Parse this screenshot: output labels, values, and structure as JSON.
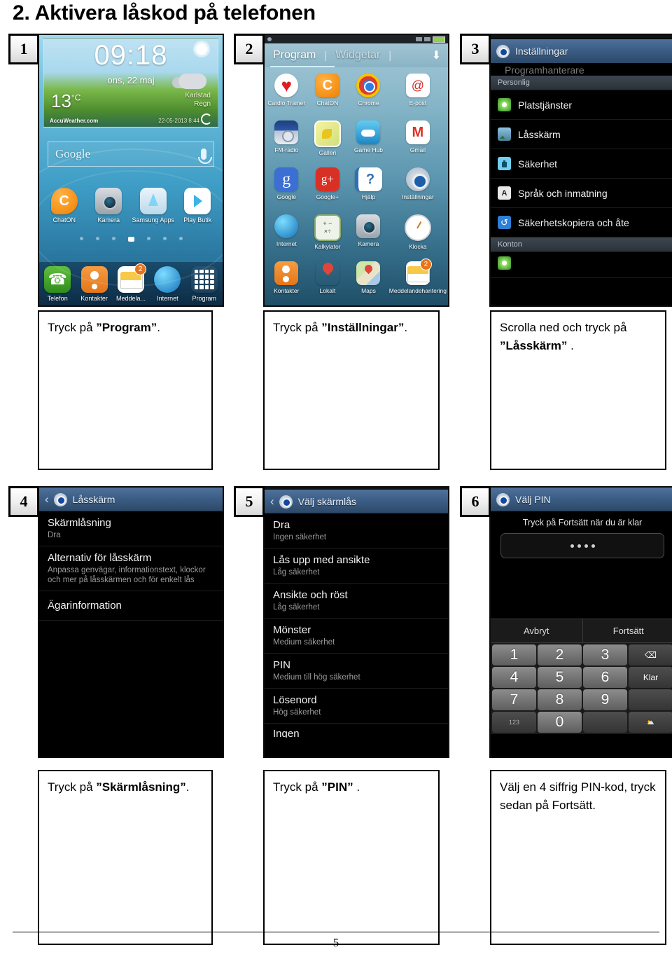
{
  "page": {
    "title": "2. Aktivera låskod på telefonen",
    "number": "5"
  },
  "steps": [
    {
      "number": "1",
      "caption_pre": "Tryck på ",
      "caption_bold": "”Program”",
      "caption_post": "."
    },
    {
      "number": "2",
      "caption_pre": "Tryck på ",
      "caption_bold": "”Inställningar”",
      "caption_post": "."
    },
    {
      "number": "3",
      "caption_pre": "Scrolla ned och tryck på ",
      "caption_bold": "”Låsskärm”",
      "caption_post": " ."
    },
    {
      "number": "4",
      "caption_pre": "Tryck på ",
      "caption_bold": "”Skärmlåsning”",
      "caption_post": "."
    },
    {
      "number": "5",
      "caption_pre": "Tryck på ",
      "caption_bold": "”PIN”",
      "caption_post": " ."
    },
    {
      "number": "6",
      "caption_pre": "Välj en 4 siffrig PIN-kod, tryck sedan på Fortsätt.",
      "caption_bold": "",
      "caption_post": ""
    }
  ],
  "panel1": {
    "widget": {
      "clock": "09:18",
      "date": "ons, 22 maj",
      "temperature": "13",
      "degree": "°C",
      "city": "Karlstad",
      "condition": "Regn",
      "brand": "AccuWeather.com",
      "updated": "22-05-2013 8:44"
    },
    "search": {
      "label": "Google"
    },
    "apps": [
      {
        "label": "ChatON",
        "icon": "chaton-icon"
      },
      {
        "label": "Kamera",
        "icon": "camera-icon"
      },
      {
        "label": "Samsung Apps",
        "icon": "samsung-apps-icon"
      },
      {
        "label": "Play Butik",
        "icon": "play-store-icon"
      }
    ],
    "dock": [
      {
        "label": "Telefon",
        "icon": "phone-icon",
        "badge": ""
      },
      {
        "label": "Kontakter",
        "icon": "contacts-icon",
        "badge": ""
      },
      {
        "label": "Meddela...",
        "icon": "messages-icon",
        "badge": "2"
      },
      {
        "label": "Internet",
        "icon": "browser-icon",
        "badge": ""
      },
      {
        "label": "Program",
        "icon": "app-drawer-icon",
        "badge": ""
      }
    ]
  },
  "panel2": {
    "tabs": {
      "apps": "Program",
      "widgets": "Widgetar",
      "separator": "|",
      "download_icon": "download-icon"
    },
    "apps": [
      {
        "label": "Cardio Trainer",
        "icon": "cardio-trainer-icon"
      },
      {
        "label": "ChatON",
        "icon": "chaton-icon"
      },
      {
        "label": "Chrome",
        "icon": "chrome-icon"
      },
      {
        "label": "E-post",
        "icon": "email-icon"
      },
      {
        "label": "FM-radio",
        "icon": "fm-radio-icon"
      },
      {
        "label": "Galleri",
        "icon": "gallery-icon"
      },
      {
        "label": "Game Hub",
        "icon": "game-hub-icon"
      },
      {
        "label": "Gmail",
        "icon": "gmail-icon"
      },
      {
        "label": "Google",
        "icon": "google-icon"
      },
      {
        "label": "Google+",
        "icon": "google-plus-icon"
      },
      {
        "label": "Hjälp",
        "icon": "help-icon"
      },
      {
        "label": "Inställningar",
        "icon": "settings-icon"
      },
      {
        "label": "Internet",
        "icon": "browser-icon"
      },
      {
        "label": "Kalkylator",
        "icon": "calculator-icon"
      },
      {
        "label": "Kamera",
        "icon": "camera-icon"
      },
      {
        "label": "Klocka",
        "icon": "clock-icon"
      },
      {
        "label": "Kontakter",
        "icon": "contacts-icon"
      },
      {
        "label": "Lokalt",
        "icon": "local-pin-icon"
      },
      {
        "label": "Maps",
        "icon": "maps-icon"
      },
      {
        "label": "Meddelandehantering",
        "icon": "messages-icon"
      }
    ]
  },
  "panel3": {
    "header": "Inställningar",
    "clipped_row": "Programhanterare",
    "section_personal": "Personlig",
    "section_accounts": "Konton",
    "items": [
      {
        "label": "Platstjänster",
        "icon": "location-icon"
      },
      {
        "label": "Låsskärm",
        "icon": "lock-screen-icon"
      },
      {
        "label": "Säkerhet",
        "icon": "security-lock-icon"
      },
      {
        "label": "Språk och inmatning",
        "icon": "language-icon"
      },
      {
        "label": "Säkerhetskopiera och åte",
        "icon": "backup-restore-icon"
      }
    ]
  },
  "panel4": {
    "header": "Låsskärm",
    "back_icon": "back-chevron-icon",
    "gear_icon": "settings-gear-icon",
    "items": [
      {
        "title": "Skärmlåsning",
        "subtitle": "Dra"
      },
      {
        "title": "Alternativ för låsskärm",
        "subtitle": "Anpassa genvägar, informationstext, klockor och mer på låsskärmen och för enkelt lås"
      },
      {
        "title": "Ägarinformation",
        "subtitle": ""
      }
    ]
  },
  "panel5": {
    "header": "Välj skärmlås",
    "back_icon": "back-chevron-icon",
    "gear_icon": "settings-gear-icon",
    "items": [
      {
        "title": "Dra",
        "subtitle": "Ingen säkerhet"
      },
      {
        "title": "Lås upp med ansikte",
        "subtitle": "Låg säkerhet"
      },
      {
        "title": "Ansikte och röst",
        "subtitle": "Låg säkerhet"
      },
      {
        "title": "Mönster",
        "subtitle": "Medium säkerhet"
      },
      {
        "title": "PIN",
        "subtitle": "Medium till hög säkerhet"
      },
      {
        "title": "Lösenord",
        "subtitle": "Hög säkerhet"
      },
      {
        "title": "Ingen",
        "subtitle": ""
      }
    ]
  },
  "panel6": {
    "header": "Välj PIN",
    "gear_icon": "settings-gear-icon",
    "hint": "Tryck på Fortsätt när du är klar",
    "pin_dots": 4,
    "cancel": "Avbryt",
    "continue": "Fortsätt",
    "keys": [
      "1",
      "2",
      "3",
      "4",
      "5",
      "6",
      "7",
      "8",
      "9"
    ],
    "backspace_icon": "backspace-icon",
    "done_key": "Klar",
    "symbols_key": "123",
    "zero_key": "0",
    "mic_icon": "microphone-icon"
  },
  "colors": {
    "actionbar": "#3c5e86",
    "list_bg": "#000000",
    "accent": "#cfefff"
  }
}
